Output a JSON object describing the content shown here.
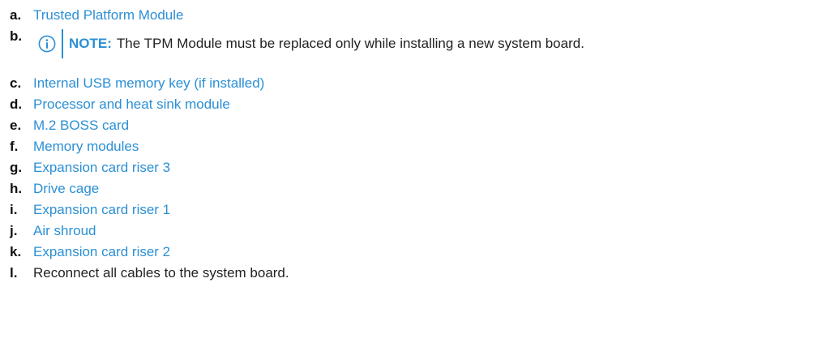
{
  "steps": [
    {
      "marker": "a.",
      "text": "Trusted Platform Module",
      "link": true
    },
    {
      "marker": "b.",
      "note": {
        "label": "NOTE:",
        "text": "The TPM Module must be replaced only while installing a new system board."
      }
    },
    {
      "marker": "c.",
      "text": "Internal USB memory key (if installed)",
      "link": true
    },
    {
      "marker": "d.",
      "text": "Processor and heat sink module",
      "link": true
    },
    {
      "marker": "e.",
      "text": "M.2 BOSS card",
      "link": true
    },
    {
      "marker": "f.",
      "text": "Memory modules",
      "link": true
    },
    {
      "marker": "g.",
      "text": "Expansion card riser 3",
      "link": true
    },
    {
      "marker": "h.",
      "text": "Drive cage",
      "link": true
    },
    {
      "marker": "i.",
      "text": "Expansion card riser 1",
      "link": true
    },
    {
      "marker": "j.",
      "text": "Air shroud",
      "link": true
    },
    {
      "marker": "k.",
      "text": "Expansion card riser 2",
      "link": true
    },
    {
      "marker": "l.",
      "text": "Reconnect all cables to the system board.",
      "link": false
    }
  ],
  "colors": {
    "link": "#2b8fd4",
    "text": "#222222",
    "note_accent": "#2b8fd4"
  },
  "icons": {
    "note": "info-icon"
  }
}
